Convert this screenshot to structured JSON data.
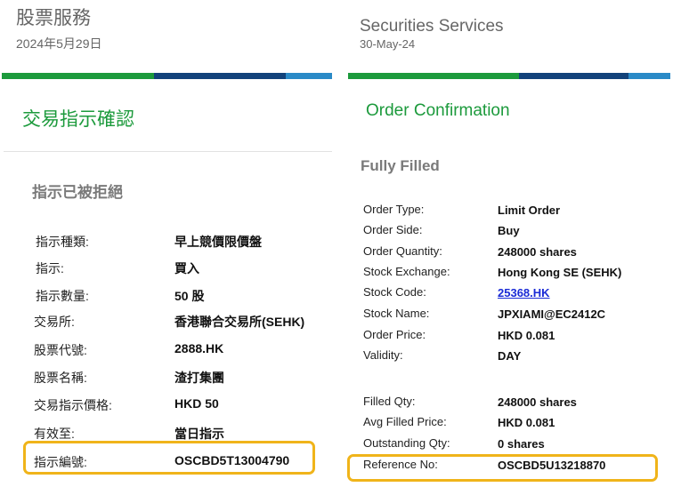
{
  "left": {
    "header": {
      "title": "股票服務",
      "date": "2024年5月29日"
    },
    "confirmation_title": "交易指示確認",
    "status": "指示已被拒絕",
    "rows": [
      {
        "label": "指示種類:",
        "value": "早上競價限價盤"
      },
      {
        "label": "指示:",
        "value": "買入"
      },
      {
        "label": "指示數量:",
        "value": "50 股"
      },
      {
        "label": "交易所:",
        "value": "香港聯合交易所(SEHK)"
      },
      {
        "label": "股票代號:",
        "value": "2888.HK"
      },
      {
        "label": "股票名稱:",
        "value": "渣打集團"
      },
      {
        "label": "交易指示價格:",
        "value": "HKD 50"
      },
      {
        "label": "有效至:",
        "value": "當日指示"
      },
      {
        "label": "指示編號:",
        "value": "OSCBD5T13004790"
      }
    ]
  },
  "right": {
    "header": {
      "title": "Securities Services",
      "date": "30-May-24"
    },
    "confirmation_title": "Order Confirmation",
    "status": "Fully Filled",
    "rows": [
      {
        "label": "Order Type:",
        "value": "Limit Order"
      },
      {
        "label": "Order Side:",
        "value": "Buy"
      },
      {
        "label": "Order Quantity:",
        "value": "248000 shares"
      },
      {
        "label": "Stock Exchange:",
        "value": "Hong Kong SE (SEHK)"
      },
      {
        "label": "Stock Code:",
        "value": "25368.HK"
      },
      {
        "label": "Stock Name:",
        "value": "JPXIAMI@EC2412C"
      },
      {
        "label": "Order Price:",
        "value": "HKD 0.081"
      },
      {
        "label": "Validity:",
        "value": "DAY"
      },
      {
        "label": "Filled Qty:",
        "value": "248000 shares"
      },
      {
        "label": "Avg Filled Price:",
        "value": "HKD 0.081"
      },
      {
        "label": "Outstanding Qty:",
        "value": "0 shares"
      },
      {
        "label": "Reference No:",
        "value": "OSCBD5U13218870"
      }
    ]
  },
  "colors": {
    "green": "#1c9a3c",
    "navy": "#12427a",
    "light_blue": "#2a8ac7",
    "highlight": "#f0b41a",
    "link": "#1a2bd6"
  }
}
